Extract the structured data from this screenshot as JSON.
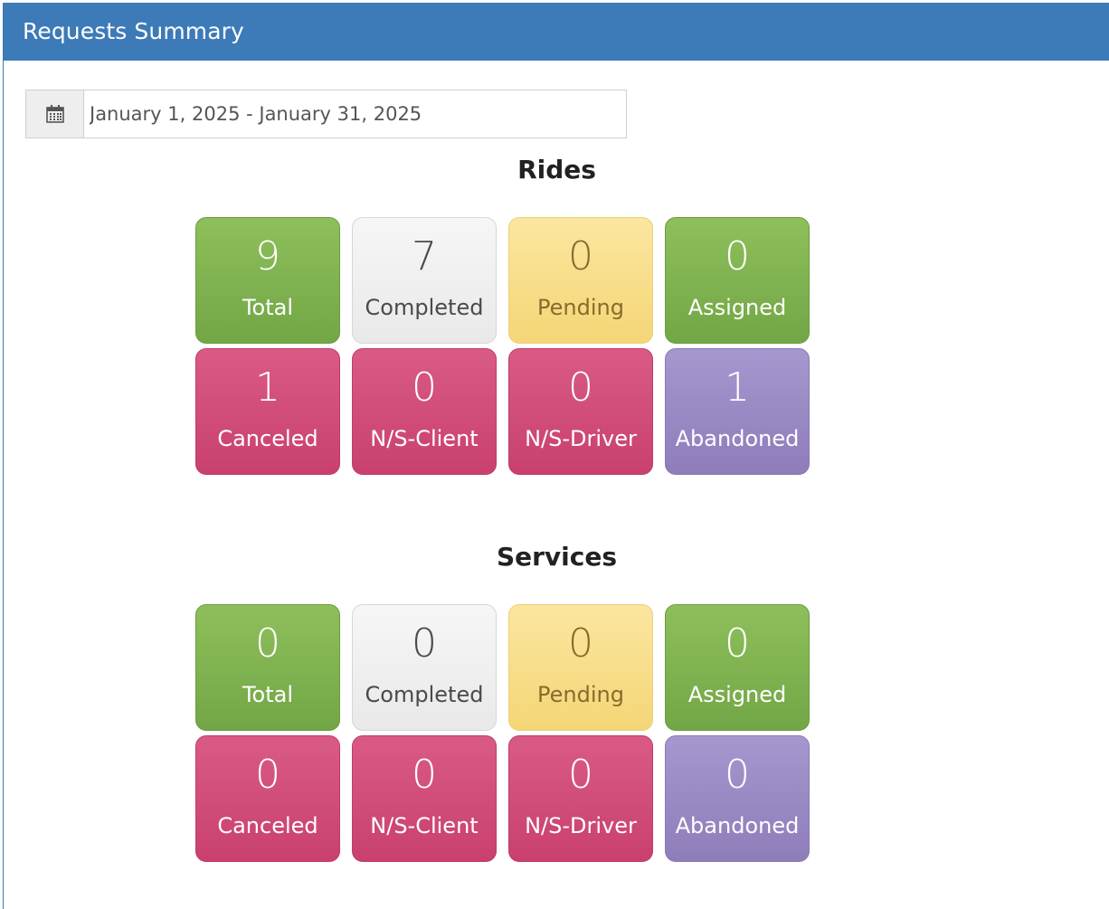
{
  "panel": {
    "title": "Requests Summary"
  },
  "date_range": {
    "icon": "calendar-icon",
    "value": "January 1, 2025 - January 31, 2025"
  },
  "colors": {
    "header": "#3d7ab8",
    "green": "#7fb351",
    "grey": "#efefef",
    "yellow": "#f8dd8a",
    "pink": "#d04d7a",
    "purple": "#9a8ac4"
  },
  "rides": {
    "title": "Rides",
    "total": {
      "value": "9",
      "label": "Total"
    },
    "completed": {
      "value": "7",
      "label": "Completed"
    },
    "pending": {
      "value": "0",
      "label": "Pending"
    },
    "assigned": {
      "value": "0",
      "label": "Assigned"
    },
    "canceled": {
      "value": "1",
      "label": "Canceled"
    },
    "ns_client": {
      "value": "0",
      "label": "N/S-Client"
    },
    "ns_driver": {
      "value": "0",
      "label": "N/S-Driver"
    },
    "abandoned": {
      "value": "1",
      "label": "Abandoned"
    }
  },
  "services": {
    "title": "Services",
    "total": {
      "value": "0",
      "label": "Total"
    },
    "completed": {
      "value": "0",
      "label": "Completed"
    },
    "pending": {
      "value": "0",
      "label": "Pending"
    },
    "assigned": {
      "value": "0",
      "label": "Assigned"
    },
    "canceled": {
      "value": "0",
      "label": "Canceled"
    },
    "ns_client": {
      "value": "0",
      "label": "N/S-Client"
    },
    "ns_driver": {
      "value": "0",
      "label": "N/S-Driver"
    },
    "abandoned": {
      "value": "0",
      "label": "Abandoned"
    }
  }
}
